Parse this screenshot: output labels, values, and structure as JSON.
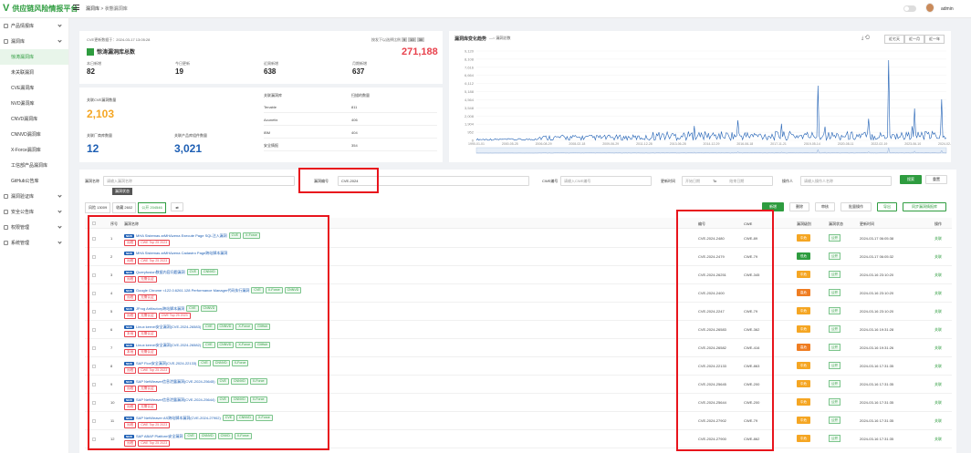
{
  "app": {
    "title": "供应链风险情报平台",
    "breadcrumb_root": "漏洞库",
    "breadcrumb_current": "状態漏洞库",
    "user": "admin"
  },
  "sidebar": [
    {
      "label": "产品情报库",
      "icon": "product-icon",
      "expand": true
    },
    {
      "label": "漏洞库",
      "icon": "vuln-icon",
      "expand": true
    },
    {
      "label": "惊涛漏洞库",
      "sub": true,
      "active": true
    },
    {
      "label": "未关联漏洞",
      "sub": true
    },
    {
      "label": "CVE漏洞库",
      "sub": true
    },
    {
      "label": "NVD漏洞库",
      "sub": true
    },
    {
      "label": "CNVD漏洞库",
      "sub": true
    },
    {
      "label": "CNNVD漏洞库",
      "sub": true
    },
    {
      "label": "X-Force漏洞库",
      "sub": true
    },
    {
      "label": "工信部产品漏洞库",
      "sub": true
    },
    {
      "label": "GitHub公告库",
      "sub": true
    },
    {
      "label": "漏洞验证库",
      "icon": "verify-icon",
      "expand": true
    },
    {
      "label": "安全公告库",
      "icon": "notice-icon",
      "expand": true
    },
    {
      "label": "权限管理",
      "icon": "perm-icon",
      "expand": true
    },
    {
      "label": "系统管理",
      "icon": "system-icon",
      "expand": true
    }
  ],
  "overview": {
    "update": "CVE更新数据于：2024-03-17 13:05:28",
    "range_label": "按发下以选择比例",
    "range_btns": [
      "9",
      "10",
      "30"
    ],
    "title": "惊涛漏洞库总数",
    "total": "271,188",
    "stats": [
      {
        "label": "本日新增",
        "value": "82"
      },
      {
        "label": "今日更新",
        "value": "19"
      },
      {
        "label": "近周新增",
        "value": "638"
      },
      {
        "label": "月期新增",
        "value": "637"
      }
    ]
  },
  "mapping": {
    "vuln_label": "关联CVE漏洞数量",
    "vuln_value": "2,103",
    "vendor_label": "关联厂商库数量",
    "vendor_value": "12",
    "product_label": "关联产品库组件数量",
    "product_value": "3,021",
    "col1": "关联漏洞库",
    "col2": "扫描的数量",
    "rows": [
      {
        "name": "Tenable",
        "count": "811"
      },
      {
        "name": "Acunetix",
        "count": "406"
      },
      {
        "name": "IBM",
        "count": "404"
      },
      {
        "name": "安全情报",
        "count": "354"
      }
    ]
  },
  "trend": {
    "title": "漏洞库变化趋势",
    "legend": "漏洞总数",
    "btns": [
      "近七天",
      "近一月",
      "近一年"
    ],
    "yticks": [
      "9,120",
      "8,108",
      "7,616",
      "6,664",
      "6,112",
      "5,188",
      "4,564",
      "3,548",
      "2,008",
      "1,904",
      "952",
      "0"
    ],
    "xticks": [
      "1990-01-01",
      "2000-05-25",
      "2006-08-29",
      "2008-02-18",
      "2009-06-29",
      "2011-12-28",
      "2013-06-28",
      "2014-12-29",
      "2016-06-18",
      "2017-11-21",
      "2019-05-14",
      "2020-08-11",
      "2022-02-19",
      "2023-06-10",
      "2024-02-28"
    ]
  },
  "filters": {
    "name_label": "漏洞名称",
    "name_ph": "请输入漏洞名称",
    "id_label": "漏洞编号",
    "id_value": "CVE-2024",
    "cwe_label": "CWE编号",
    "cwe_ph": "请输入CWE编号",
    "date_label": "更新时间",
    "date_start": "开始日期",
    "date_to": "To",
    "date_end": "结束日期",
    "person_label": "操作人",
    "person_ph": "请输入操作人名称",
    "search": "搜索",
    "reset": "重置"
  },
  "tabs": {
    "items": [
      "风险 13009",
      "收藏 2602",
      "公开 204546"
    ],
    "tooltip": "漏洞状态"
  },
  "actions": {
    "add": "新增",
    "del": "删除",
    "audit": "审核",
    "import": "批量操作",
    "export": "导出",
    "sync": "同步漏洞情报库"
  },
  "table": {
    "headers": [
      "序号",
      "漏洞名称",
      "编号",
      "CWE",
      "漏洞级别",
      "漏洞状态",
      "更新时间",
      "操作"
    ]
  },
  "rows": [
    {
      "no": "1",
      "name": "MHA Sistemas arMHAzena Execute Page SQL注入漏洞",
      "tags": [
        "CVE",
        "X-Force"
      ],
      "r": [
        "远程",
        "CWE Top 25 2023"
      ],
      "cve": "CVE-2024-2480",
      "cwe": "CWE-89",
      "level": "中危",
      "lc": "#f5a623",
      "status": "公开",
      "time": "2024-03-17 06:05:38",
      "op": "关联"
    },
    {
      "no": "2",
      "name": "MHA Sistemas arMHAzena Cadastro Page跨站脚本漏洞",
      "tags": [],
      "r": [
        "远程",
        "CWE Top 25 2023"
      ],
      "cve": "CVE-2024-2479",
      "cwe": "CWE-79",
      "level": "低危",
      "lc": "#2e9c3f",
      "status": "公开",
      "time": "2024-03-17 06:05:32",
      "op": "关联"
    },
    {
      "no": "3",
      "name": "Queryfusion数据内容问题漏洞",
      "tags": [
        "CVE",
        "CNNVD"
      ],
      "r": [
        "远程",
        "无需认证"
      ],
      "cve": "CVE-2024-26251",
      "cwe": "CWE-345",
      "level": "中危",
      "lc": "#f5a623",
      "status": "公开",
      "time": "2024-03-16 23:10:20",
      "op": "关联"
    },
    {
      "no": "4",
      "name": "Google Chrome <122.0.6261.128 Performance Manager代码执行漏洞",
      "tags": [
        "CVE",
        "X-Force",
        "CNNVD"
      ],
      "r": [
        "远程",
        "无需认证"
      ],
      "cve": "CVE-2024-2400",
      "cwe": "",
      "level": "高危",
      "lc": "#ef7d22",
      "status": "公开",
      "time": "2024-03-16 23:10:20",
      "op": "关联"
    },
    {
      "no": "5",
      "name": "JFrog Artifactory跨站脚本漏洞",
      "tags": [
        "CVE",
        "CNNVD"
      ],
      "r": [
        "远程",
        "无需认证",
        "CWE Top 25 2023"
      ],
      "cve": "CVE-2024-2247",
      "cwe": "CWE-79",
      "level": "中危",
      "lc": "#f5a623",
      "status": "公开",
      "time": "2024-03-16 23:10:20",
      "op": "关联"
    },
    {
      "no": "6",
      "name": "Linux kernel安全漏洞(CVE-2024-26583)",
      "tags": [
        "CVE",
        "CNNVD",
        "X-Force",
        "GitHub"
      ],
      "r": [
        "本地",
        "无需认证"
      ],
      "cve": "CVE-2024-26583",
      "cwe": "CWE-362",
      "level": "中危",
      "lc": "#f5a623",
      "status": "公开",
      "time": "2024-03-16 19:31:28",
      "op": "关联"
    },
    {
      "no": "7",
      "name": "Linux kernel安全漏洞(CVE-2024-26582)",
      "tags": [
        "CVE",
        "CNNVD",
        "X-Force",
        "GitHub"
      ],
      "r": [
        "本地",
        "无需认证"
      ],
      "cve": "CVE-2024-26582",
      "cwe": "CWE-416",
      "level": "高危",
      "lc": "#ef7d22",
      "status": "公开",
      "time": "2024-03-16 19:31:26",
      "op": "关联"
    },
    {
      "no": "8",
      "name": "SAP Fiori安全漏洞(CVE-2024-22133)",
      "tags": [
        "CVE",
        "CNNVD",
        "X-Force"
      ],
      "r": [
        "远程",
        "CWE Top 25 2023"
      ],
      "cve": "CVE-2024-22133",
      "cwe": "CWE-863",
      "level": "中危",
      "lc": "#f5a623",
      "status": "公开",
      "time": "2024-03-16 17:31:35",
      "op": "关联"
    },
    {
      "no": "9",
      "name": "SAP NetWeaver信息泄露漏洞(CVE-2024-25645)",
      "tags": [
        "CVE",
        "CNNVD",
        "X-Force"
      ],
      "r": [
        "远程",
        "无需认证"
      ],
      "cve": "CVE-2024-25645",
      "cwe": "CWE-200",
      "level": "中危",
      "lc": "#f5a623",
      "status": "公开",
      "time": "2024-03-16 17:31:35",
      "op": "关联"
    },
    {
      "no": "10",
      "name": "SAP NetWeaver信息泄露漏洞(CVE-2024-25644)",
      "tags": [
        "CVE",
        "CNNVD",
        "X-Force"
      ],
      "r": [
        "远程",
        "无需认证"
      ],
      "cve": "CVE-2024-25644",
      "cwe": "CWE-200",
      "level": "中危",
      "lc": "#f5a623",
      "status": "公开",
      "time": "2024-03-16 17:31:35",
      "op": "关联"
    },
    {
      "no": "11",
      "name": "SAP NetWeaver AS跨站脚本漏洞(CVE-2024-27902)",
      "tags": [
        "CVE",
        "CNNVD",
        "X-Force"
      ],
      "r": [
        "远程",
        "CWE Top 25 2023"
      ],
      "cve": "CVE-2024-27902",
      "cwe": "CWE-79",
      "level": "中危",
      "lc": "#f5a623",
      "status": "公开",
      "time": "2024-03-16 17:31:35",
      "op": "关联"
    },
    {
      "no": "12",
      "name": "SAP ABAP Platform安全漏洞",
      "tags": [
        "CVE",
        "CNNVD",
        "CNVD",
        "X-Force"
      ],
      "r": [
        "远程",
        "CWE Top 25 2023"
      ],
      "cve": "CVE-2024-27900",
      "cwe": "CWE-862",
      "level": "中危",
      "lc": "#f5a623",
      "status": "公开",
      "time": "2024-03-16 17:31:35",
      "op": "关联"
    }
  ]
}
